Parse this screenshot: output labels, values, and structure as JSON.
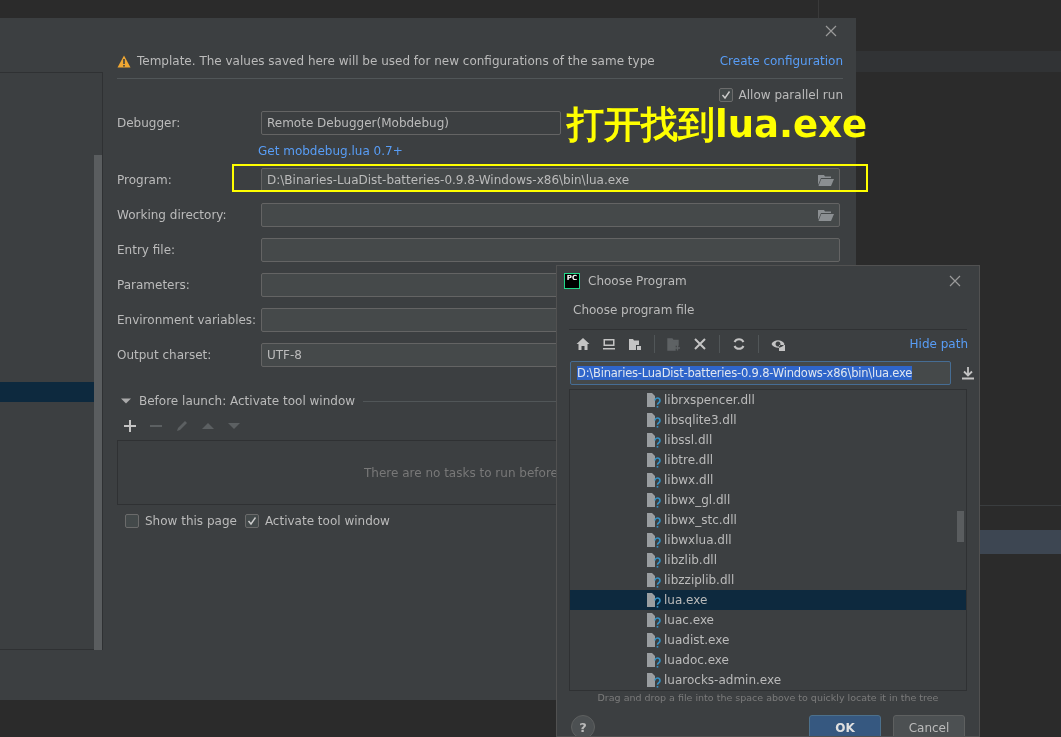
{
  "main_dialog": {
    "notice": "Template. The values saved here will be used for new configurations of the same type",
    "create_link": "Create configuration",
    "allow_parallel_run": {
      "label": "Allow parallel run",
      "checked": true
    },
    "fields": [
      {
        "label": "Debugger:",
        "kind": "dropdown",
        "value": "Remote Debugger(Mobdebug)",
        "link": "Get mobdebug.lua 0.7+",
        "highlighted": false
      },
      {
        "label": "Program:",
        "kind": "browse",
        "value": "D:\\Binaries-LuaDist-batteries-0.9.8-Windows-x86\\bin\\lua.exe",
        "highlighted": true
      },
      {
        "label": "Working directory:",
        "kind": "browse",
        "highlighted": false
      },
      {
        "label": "Entry file:",
        "kind": "text",
        "highlighted": false
      },
      {
        "label": "Parameters:",
        "kind": "text",
        "highlighted": false
      },
      {
        "label": "Environment variables:",
        "kind": "text",
        "highlighted": false
      },
      {
        "label": "Output charset:",
        "kind": "text",
        "value": "UTF-8",
        "highlighted": false
      }
    ],
    "before_launch": {
      "title": "Before launch: Activate tool window",
      "expanded": true,
      "tools": [
        {
          "kind": "add",
          "disabled": false
        },
        {
          "kind": "remove",
          "disabled": true
        },
        {
          "kind": "edit",
          "disabled": true
        },
        {
          "kind": "up",
          "disabled": true
        },
        {
          "kind": "down",
          "disabled": true
        }
      ],
      "empty_text": "There are no tasks to run before"
    },
    "options": [
      {
        "label": "Show this page",
        "checked": false
      },
      {
        "label": "Activate tool window",
        "checked": true
      }
    ]
  },
  "annotation": {
    "text": "打开找到lua.exe"
  },
  "file_chooser": {
    "app_icon_text": "PC",
    "title": "Choose Program",
    "description": "Choose program file",
    "toolbar": [
      {
        "kind": "home",
        "disabled": false
      },
      {
        "kind": "desktop",
        "disabled": false
      },
      {
        "kind": "project",
        "disabled": false
      },
      {
        "kind": "new-folder",
        "disabled": true
      },
      {
        "kind": "delete",
        "disabled": false
      },
      {
        "kind": "refresh",
        "disabled": false
      },
      {
        "kind": "show-hidden",
        "disabled": false
      }
    ],
    "hide_path": "Hide path",
    "path": "D:\\Binaries-LuaDist-batteries-0.9.8-Windows-x86\\bin\\lua.exe",
    "path_selected": true,
    "files": [
      {
        "name": "librxspencer.dll",
        "selected": false
      },
      {
        "name": "libsqlite3.dll",
        "selected": false
      },
      {
        "name": "libssl.dll",
        "selected": false
      },
      {
        "name": "libtre.dll",
        "selected": false
      },
      {
        "name": "libwx.dll",
        "selected": false
      },
      {
        "name": "libwx_gl.dll",
        "selected": false
      },
      {
        "name": "libwx_stc.dll",
        "selected": false
      },
      {
        "name": "libwxlua.dll",
        "selected": false
      },
      {
        "name": "libzlib.dll",
        "selected": false
      },
      {
        "name": "libzziplib.dll",
        "selected": false
      },
      {
        "name": "lua.exe",
        "selected": true
      },
      {
        "name": "luac.exe",
        "selected": false
      },
      {
        "name": "luadist.exe",
        "selected": false
      },
      {
        "name": "luadoc.exe",
        "selected": false
      },
      {
        "name": "luarocks-admin.exe",
        "selected": false
      }
    ],
    "hint": "Drag and drop a file into the space above to quickly locate it in the tree",
    "help": "?",
    "buttons": [
      {
        "label": "OK",
        "kind": "default"
      },
      {
        "label": "Cancel",
        "kind": "normal"
      }
    ]
  }
}
